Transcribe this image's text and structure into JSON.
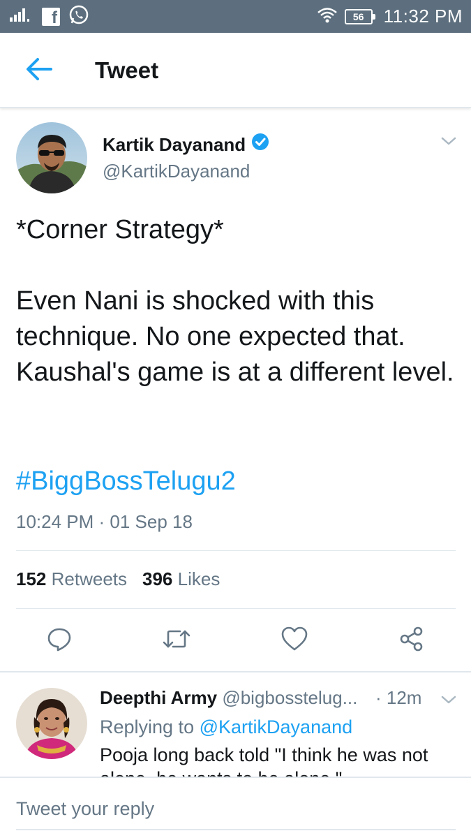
{
  "status_bar": {
    "time": "11:32 PM",
    "battery": "56",
    "icons": [
      "signal-icon",
      "facebook-icon",
      "whatsapp-icon",
      "wifi-icon",
      "battery-icon"
    ]
  },
  "header": {
    "title": "Tweet",
    "back_icon": "arrow-left-icon"
  },
  "tweet": {
    "author_name": "Kartik Dayanand",
    "verified": true,
    "handle": "@KartikDayanand",
    "text_line1": "*Corner Strategy*",
    "text_line2": "Even Nani is shocked with this technique. No one expected that. Kaushal's game is at a different level.",
    "hashtag": "#BiggBossTelugu2",
    "timestamp": "10:24 PM · 01 Sep 18",
    "retweets_count": "152",
    "retweets_label": "Retweets",
    "likes_count": "396",
    "likes_label": "Likes",
    "actions": [
      "reply-icon",
      "retweet-icon",
      "like-icon",
      "share-icon"
    ]
  },
  "reply": {
    "name": "Deepthi Army",
    "handle": "@bigbosstelug...",
    "time": "· 12m",
    "replying_prefix": "Replying to",
    "replying_mention": "@KartikDayanand",
    "text": "Pooja long back told \"I think he was not alone, he wants to be alone.\""
  },
  "composer": {
    "placeholder": "Tweet your reply"
  },
  "colors": {
    "accent": "#1da1f2",
    "secondary_text": "#657786",
    "status_bar": "#5d6f7e",
    "divider": "#e1e8ed"
  }
}
